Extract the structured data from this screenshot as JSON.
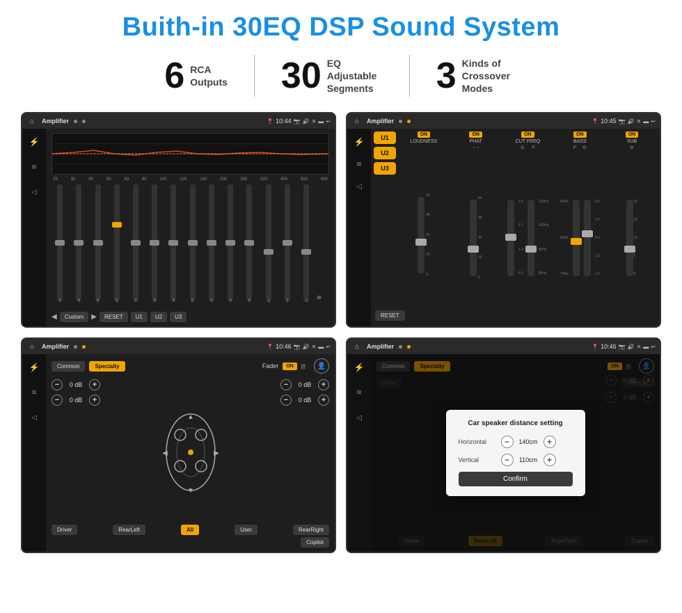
{
  "page": {
    "title": "Buith-in 30EQ DSP Sound System",
    "stats": [
      {
        "number": "6",
        "text": "RCA\nOutputs"
      },
      {
        "number": "30",
        "text": "EQ Adjustable\nSegments"
      },
      {
        "number": "3",
        "text": "Kinds of\nCrossover Modes"
      }
    ]
  },
  "screens": {
    "eq": {
      "title": "Amplifier",
      "time": "10:44",
      "graph": "EQ curve",
      "freq_labels": [
        "25",
        "32",
        "40",
        "50",
        "63",
        "80",
        "100",
        "125",
        "160",
        "200",
        "250",
        "320",
        "400",
        "500",
        "630"
      ],
      "slider_values": [
        "0",
        "0",
        "0",
        "5",
        "0",
        "0",
        "0",
        "0",
        "0",
        "0",
        "0",
        "-1",
        "0",
        "-1"
      ],
      "bottom_btns": [
        "Custom",
        "RESET",
        "U1",
        "U2",
        "U3"
      ]
    },
    "crossover": {
      "title": "Amplifier",
      "time": "10:45",
      "u_btns": [
        "U1",
        "U2",
        "U3"
      ],
      "channels": [
        "LOUDNESS",
        "PHAT",
        "CUT FREQ",
        "BASS",
        "SUB"
      ],
      "reset_label": "RESET"
    },
    "fader": {
      "title": "Amplifier",
      "time": "10:46",
      "tabs": [
        "Common",
        "Specialty"
      ],
      "fader_label": "Fader",
      "on_label": "ON",
      "db_values": [
        "0 dB",
        "0 dB",
        "0 dB",
        "0 dB"
      ],
      "bottom_btns": [
        "Driver",
        "All",
        "User",
        "RearRight",
        "RearLeft",
        "Copilot"
      ]
    },
    "dialog": {
      "title": "Amplifier",
      "time": "10:46",
      "tabs": [
        "Common",
        "Specialty"
      ],
      "on_label": "ON",
      "dialog_title": "Car speaker distance setting",
      "horizontal_label": "Horizontal",
      "horizontal_value": "140cm",
      "vertical_label": "Vertical",
      "vertical_value": "110cm",
      "confirm_label": "Confirm",
      "db_values": [
        "0 dB",
        "0 dB"
      ],
      "bottom_btns": [
        "Driver",
        "RearLeft",
        "RearRight",
        "Copilot"
      ]
    }
  }
}
